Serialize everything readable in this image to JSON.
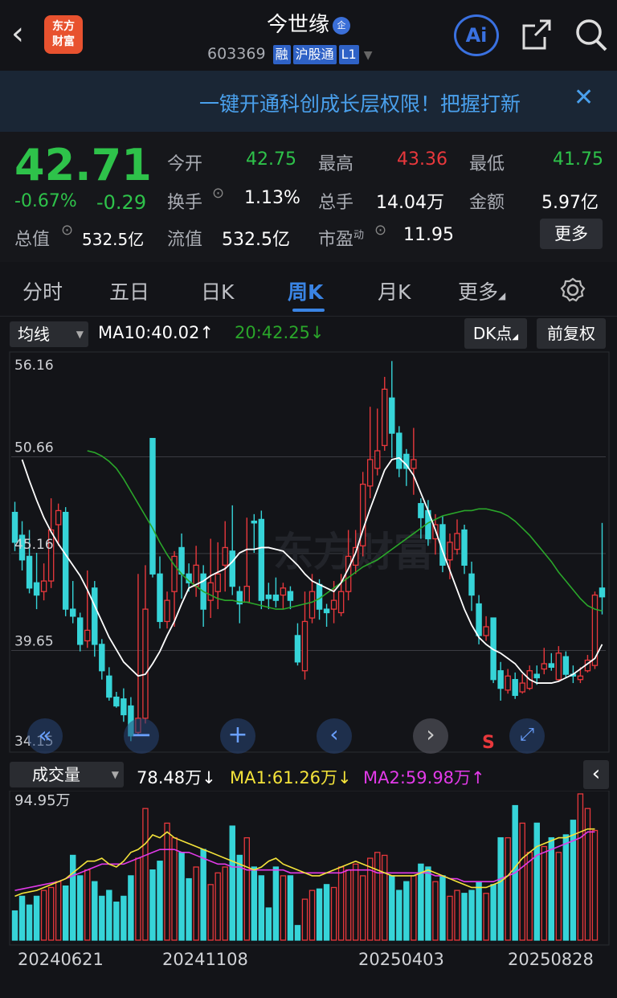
{
  "header": {
    "title": "今世缘",
    "title_badge": "企",
    "code": "603369",
    "tags": [
      "融",
      "沪股通",
      "L1"
    ],
    "logo": "东方\n财富",
    "logo_line1": "东方",
    "logo_line2": "财富",
    "ai": "Ai"
  },
  "banner": {
    "text": "一键开通科创成长层权限！把握打新",
    "close": "✕"
  },
  "quote": {
    "price": "42.71",
    "change_pct": "-0.67%",
    "change": "-0.29",
    "rows": [
      [
        {
          "l": "今开",
          "v": "42.75",
          "c": "green"
        },
        {
          "l": "最高",
          "v": "43.36",
          "c": "red"
        },
        {
          "l": "最低",
          "v": "41.75",
          "c": "green"
        }
      ],
      [
        {
          "l": "换手",
          "v": "1.13%",
          "c": "white"
        },
        {
          "l": "总手",
          "v": "14.04万",
          "c": "white"
        },
        {
          "l": "金额",
          "v": "5.97亿",
          "c": "white"
        }
      ],
      [
        {
          "l": "流值",
          "v": "532.5亿",
          "c": "white"
        },
        {
          "l": "市盈",
          "v": "11.95",
          "c": "white"
        }
      ]
    ],
    "total_value_label": "总值",
    "total_value": "532.5亿",
    "pe_sup": "动",
    "more": "更多"
  },
  "tabs": [
    "分时",
    "五日",
    "日K",
    "周K",
    "月K",
    "更多"
  ],
  "active_tab": "周K",
  "chart_toolbar": {
    "ma_select": "均线",
    "ma10": "MA10:40.02",
    "ma20": "20:42.25",
    "dk": "DK点",
    "fq": "前复权"
  },
  "price_axis": [
    "56.16",
    "50.66",
    "45.16",
    "39.65",
    "34.15"
  ],
  "sell_marker": "S",
  "vol_toolbar": {
    "select": "成交量",
    "vol": "78.48万",
    "ma1": "MA1:61.26万",
    "ma2": "MA2:59.98万",
    "axis_max": "94.95万"
  },
  "dates": [
    "20240621",
    "20241108",
    "20250403",
    "20250828"
  ],
  "colors": {
    "up": "#e8383c",
    "down": "#36d4d8",
    "ma10": "#ffffff",
    "ma20": "#2aa62a",
    "volma1": "#f4e33a",
    "volma2": "#e23ae8"
  },
  "chart_data": {
    "type": "candlestick",
    "x_range": [
      "20240621",
      "20250828"
    ],
    "y_range": [
      34.15,
      56.16
    ],
    "candles": [
      [
        47.5,
        45.8,
        48.1,
        45.3
      ],
      [
        46.2,
        44.8,
        47.0,
        44.2
      ],
      [
        45.0,
        43.2,
        46.5,
        42.9
      ],
      [
        43.5,
        42.8,
        45.2,
        42.0
      ],
      [
        43.0,
        43.6,
        44.6,
        42.5
      ],
      [
        43.6,
        46.5,
        48.3,
        43.2
      ],
      [
        46.8,
        47.6,
        48.0,
        45.6
      ],
      [
        47.5,
        42.0,
        47.8,
        41.6
      ],
      [
        42.0,
        41.6,
        43.6,
        41.2
      ],
      [
        41.5,
        40.0,
        41.8,
        39.6
      ],
      [
        40.2,
        40.8,
        44.2,
        39.8
      ],
      [
        43.2,
        40.0,
        43.6,
        39.3
      ],
      [
        40.0,
        38.5,
        40.3,
        38.0
      ],
      [
        38.2,
        37.0,
        38.7,
        36.8
      ],
      [
        37.0,
        36.5,
        37.3,
        36.4
      ],
      [
        36.9,
        36.0,
        37.5,
        35.6
      ],
      [
        36.5,
        34.8,
        37.0,
        34.5
      ],
      [
        35.0,
        35.8,
        44.0,
        34.8
      ],
      [
        35.8,
        42.0,
        44.5,
        35.5
      ],
      [
        51.7,
        44.0,
        51.7,
        43.8
      ],
      [
        44.0,
        41.3,
        45.0,
        40.9
      ],
      [
        41.3,
        42.5,
        43.0,
        40.9
      ],
      [
        43.0,
        45.0,
        45.3,
        41.0
      ],
      [
        45.5,
        44.0,
        46.3,
        42.6
      ],
      [
        44.0,
        43.5,
        44.6,
        43.0
      ],
      [
        43.3,
        44.5,
        45.6,
        42.7
      ],
      [
        44.0,
        42.0,
        44.5,
        41.0
      ],
      [
        42.5,
        43.5,
        46.0,
        41.5
      ],
      [
        43.0,
        44.0,
        45.8,
        42.0
      ],
      [
        44.5,
        45.5,
        47.0,
        43.0
      ],
      [
        45.3,
        43.3,
        47.9,
        42.8
      ],
      [
        43.0,
        42.3,
        43.3,
        41.2
      ],
      [
        42.4,
        43.3,
        47.2,
        42.5
      ],
      [
        47.0,
        46.9,
        47.4,
        45.2
      ],
      [
        47.1,
        42.5,
        47.6,
        42.0
      ],
      [
        42.8,
        42.6,
        43.5,
        42.0
      ],
      [
        42.8,
        42.5,
        43.8,
        42.1
      ],
      [
        42.8,
        43.2,
        43.5,
        42.0
      ],
      [
        43.0,
        42.5,
        43.3,
        42.0
      ],
      [
        40.5,
        39.0,
        41.2,
        38.8
      ],
      [
        38.5,
        41.3,
        43.0,
        38.0
      ],
      [
        41.5,
        43.0,
        44.0,
        41.2
      ],
      [
        43.4,
        42.0,
        43.7,
        41.4
      ],
      [
        42.0,
        41.8,
        42.3,
        41.0
      ],
      [
        42.0,
        42.5,
        43.6,
        41.2
      ],
      [
        41.8,
        43.0,
        44.0,
        41.6
      ],
      [
        43.0,
        45.0,
        46.5,
        42.5
      ],
      [
        44.5,
        45.5,
        46.5,
        44.0
      ],
      [
        45.6,
        49.1,
        49.8,
        45.0
      ],
      [
        49.0,
        50.5,
        53.5,
        48.3
      ],
      [
        50.0,
        51.0,
        53.4,
        49.6
      ],
      [
        51.3,
        54.5,
        55.2,
        51.0
      ],
      [
        54.0,
        52.0,
        56.1,
        50.6
      ],
      [
        52.0,
        50.0,
        52.4,
        49.5
      ],
      [
        50.8,
        50.0,
        51.1,
        49.0
      ],
      [
        50.0,
        50.5,
        52.3,
        48.5
      ],
      [
        48.0,
        47.2,
        48.3,
        46.0
      ],
      [
        47.6,
        46.0,
        48.2,
        45.6
      ],
      [
        46.0,
        46.8,
        47.4,
        45.1
      ],
      [
        46.8,
        44.5,
        47.3,
        44.1
      ],
      [
        44.8,
        45.8,
        46.3,
        43.7
      ],
      [
        45.4,
        46.3,
        47.1,
        45.1
      ],
      [
        46.5,
        44.5,
        46.8,
        44.0
      ],
      [
        44.0,
        42.8,
        44.7,
        41.9
      ],
      [
        42.3,
        40.5,
        42.8,
        40.0
      ],
      [
        40.5,
        41.0,
        41.6,
        40.2
      ],
      [
        41.5,
        38.0,
        41.5,
        37.8
      ],
      [
        38.5,
        37.5,
        39.0,
        36.8
      ],
      [
        37.4,
        38.2,
        38.6,
        37.2
      ],
      [
        38.0,
        37.1,
        38.4,
        36.9
      ],
      [
        37.3,
        37.8,
        38.3,
        37.2
      ],
      [
        37.5,
        38.5,
        38.8,
        37.4
      ],
      [
        38.3,
        38.1,
        38.8,
        37.7
      ],
      [
        38.6,
        38.9,
        39.8,
        38.3
      ],
      [
        38.9,
        38.7,
        39.5,
        38.5
      ],
      [
        38.0,
        39.5,
        39.9,
        37.9
      ],
      [
        39.3,
        38.3,
        39.6,
        38.1
      ],
      [
        38.3,
        38.2,
        38.8,
        37.8
      ],
      [
        38.0,
        38.2,
        38.7,
        37.8
      ],
      [
        38.5,
        39.1,
        39.4,
        38.4
      ],
      [
        38.8,
        42.8,
        43.0,
        38.6
      ],
      [
        43.2,
        42.7,
        46.9,
        41.7
      ]
    ],
    "ma10": [
      50.5,
      49.3,
      48.2,
      47.2,
      46.4,
      45.7,
      45.1,
      44.5,
      43.9,
      43.1,
      42.2,
      41.3,
      40.4,
      39.7,
      39.0,
      38.6,
      38.2,
      38.3,
      38.9,
      39.6,
      40.5,
      41.3,
      42.3,
      43.2,
      43.4,
      43.6,
      43.9,
      44.1,
      44.3,
      44.7,
      45.2,
      45.4,
      45.4,
      45.5,
      45.5,
      45.4,
      45.3,
      44.9,
      44.5,
      44.0,
      43.6,
      43.4,
      43.2,
      43.0,
      43.5,
      44.3,
      45.2,
      46.5,
      47.7,
      48.8,
      49.9,
      50.5,
      50.6,
      50.2,
      49.6,
      48.6,
      47.6,
      46.5,
      45.3,
      44.2,
      43.1,
      42.0,
      41.1,
      40.4,
      40.0,
      39.7,
      39.5,
      39.2,
      38.9,
      38.4,
      38.0,
      37.8,
      37.8,
      37.8,
      37.9,
      38.1,
      38.3,
      38.6,
      38.9,
      39.2,
      40.0
    ],
    "ma20": [
      51.0,
      50.9,
      50.7,
      50.4,
      50.0,
      49.4,
      48.7,
      48.0,
      47.3,
      46.6,
      45.8,
      45.1,
      44.5,
      44.0,
      43.6,
      43.3,
      43.0,
      42.8,
      42.6,
      42.5,
      42.5,
      42.4,
      42.4,
      42.3,
      42.2,
      42.1,
      42.0,
      42.0,
      42.1,
      42.2,
      42.3,
      42.4,
      42.6,
      42.9,
      43.2,
      43.5,
      43.8,
      44.1,
      44.4,
      44.6,
      44.8,
      45.1,
      45.4,
      45.7,
      46.0,
      46.3,
      46.6,
      46.9,
      47.1,
      47.3,
      47.4,
      47.5,
      47.6,
      47.6,
      47.7,
      47.7,
      47.6,
      47.5,
      47.3,
      47.0,
      46.6,
      46.2,
      45.7,
      45.2,
      44.7,
      44.1,
      43.6,
      43.1,
      42.6,
      42.2,
      42.0,
      41.9
    ],
    "volume": [
      20,
      30,
      24,
      30,
      34,
      36,
      40,
      37,
      58,
      44,
      48,
      40,
      30,
      34,
      26,
      30,
      44,
      56,
      90,
      48,
      54,
      80,
      70,
      60,
      42,
      50,
      62,
      38,
      46,
      50,
      78,
      58,
      70,
      50,
      44,
      22,
      50,
      44,
      44,
      10,
      28,
      34,
      35,
      38,
      36,
      50,
      48,
      52,
      44,
      56,
      60,
      58,
      44,
      34,
      40,
      44,
      52,
      50,
      40,
      44,
      30,
      34,
      32,
      34,
      40,
      32,
      38,
      70,
      70,
      92,
      80,
      60,
      80,
      64,
      70,
      60,
      72,
      82,
      100,
      90,
      75
    ],
    "vol_ma1": [
      30,
      32,
      33,
      34,
      36,
      38,
      40,
      42,
      46,
      50,
      54,
      54,
      56,
      52,
      50,
      54,
      60,
      62,
      66,
      72,
      70,
      74,
      70,
      68,
      66,
      64,
      62,
      60,
      58,
      56,
      54,
      52,
      50,
      48,
      50,
      54,
      56,
      52,
      50,
      48,
      46,
      44,
      44,
      46,
      48,
      50,
      52,
      54,
      52,
      50,
      48,
      46,
      44,
      44,
      44,
      44,
      46,
      48,
      46,
      44,
      42,
      40,
      38,
      36,
      36,
      36,
      38,
      40,
      44,
      50,
      56,
      60,
      64,
      66,
      68,
      70,
      70,
      72,
      74,
      76,
      76
    ],
    "vol_ma2": [
      34,
      35,
      36,
      37,
      38,
      39,
      40,
      42,
      44,
      46,
      48,
      50,
      52,
      52,
      52,
      52,
      54,
      56,
      58,
      60,
      62,
      62,
      62,
      60,
      60,
      58,
      56,
      54,
      52,
      52,
      50,
      50,
      48,
      48,
      48,
      48,
      48,
      48,
      46,
      46,
      46,
      46,
      46,
      46,
      46,
      46,
      48,
      48,
      48,
      48,
      46,
      46,
      46,
      46,
      46,
      46,
      46,
      46,
      44,
      44,
      42,
      42,
      40,
      40,
      40,
      40,
      40,
      42,
      44,
      46,
      50,
      54,
      58,
      60,
      62,
      64,
      66,
      68,
      70,
      74,
      74
    ]
  }
}
